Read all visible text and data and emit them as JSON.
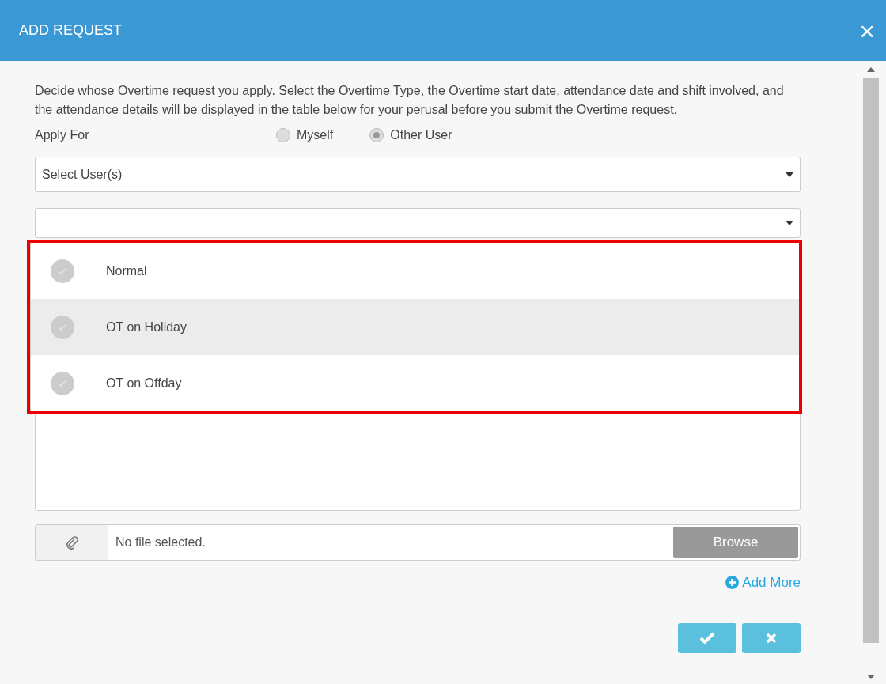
{
  "dialog": {
    "title": "ADD REQUEST",
    "close": "×"
  },
  "description": "Decide whose Overtime request you apply. Select the Overtime Type, the Overtime start date, attendance date and shift involved, and the attendance details will be displayed in the table below for your perusal before you submit the Overtime request.",
  "apply_for": {
    "label": "Apply For",
    "options": [
      {
        "label": "Myself",
        "selected": false
      },
      {
        "label": "Other User",
        "selected": true
      }
    ]
  },
  "user_select": {
    "placeholder": "Select User(s)"
  },
  "type_select": {
    "expanded": true,
    "options": [
      {
        "label": "Normal",
        "checked": false,
        "highlighted": false
      },
      {
        "label": "OT on Holiday",
        "checked": false,
        "highlighted": true
      },
      {
        "label": "OT on Offday",
        "checked": false,
        "highlighted": false
      }
    ]
  },
  "attachment": {
    "placeholder": "No file selected.",
    "browse": "Browse"
  },
  "add_more": "Add More"
}
